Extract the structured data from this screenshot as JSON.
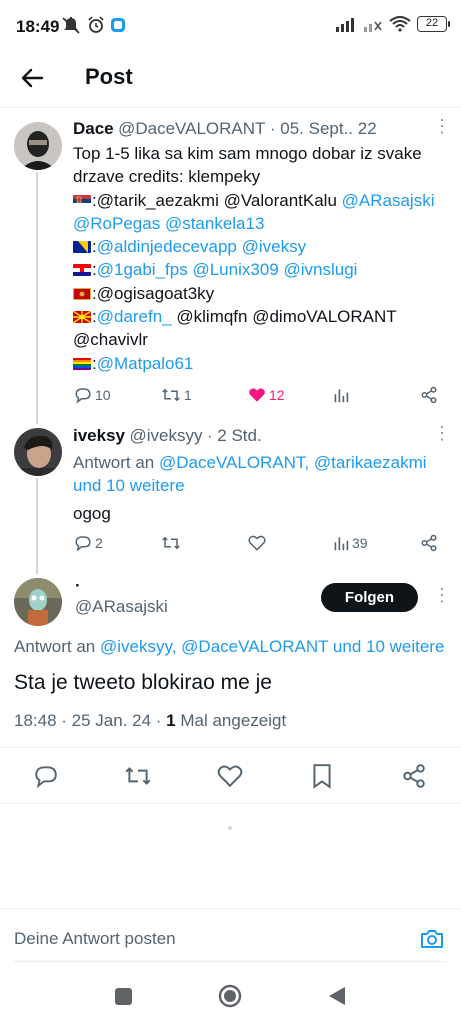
{
  "status": {
    "time": "18:49",
    "battery": "22"
  },
  "header": {
    "title": "Post"
  },
  "tweet1": {
    "name": "Dace",
    "handle": "@DaceVALORANT",
    "date": "· 05. Sept.. 22",
    "line1": "Top 1-5 lika sa kim sam mnogo dobar iz svake",
    "line2": "drzave credits: klempeky",
    "rs": ":@tarik_aezakmi @ValorantKalu ",
    "rs_m1": "@ARasajski",
    "rs_m2": "@RoPegas",
    "rs_m3": "@stankela13",
    "ba_pre": ":",
    "ba_m1": "@aldinjedecevapp",
    "ba_m2": "@iveksy",
    "hr_pre": ":",
    "hr_m1": "@1gabi_fps",
    "hr_m2": "@Lunix309",
    "hr_m3": "@ivnslugi",
    "me": ":@ogisagoat3ky",
    "mk_pre": ":",
    "mk_m1": "@darefn_",
    "mk_rest": " @klimqfn @dimoVALORANT",
    "mk_rest2": "@chavivlr",
    "rb_pre": ":",
    "rb_m1": "@Matpalo61",
    "replies": "10",
    "retweets": "1",
    "likes": "12",
    "colors": {
      "like": "#f91880"
    }
  },
  "tweet2": {
    "name": "iveksy",
    "handle": "@iveksyy",
    "time": "· 2 Std.",
    "reply_prefix": "Antwort an ",
    "reply_m1": "@DaceVALORANT,",
    "reply_m2": "@tarikaezakmi",
    "reply_more": "und 10 weitere",
    "text": "ogog",
    "replies": "2",
    "views": "39"
  },
  "main_tweet": {
    "name": "·",
    "handle": "@ARasajski",
    "follow_label": "Folgen",
    "reply_prefix": "Antwort an ",
    "reply_mentions": "@iveksyy, @DaceVALORANT und 10 weitere",
    "text": "Sta je tweeto blokirao me je",
    "meta_time": "18:48 · 25 Jan. 24 · ",
    "meta_count": "1",
    "meta_label": " Mal angezeigt"
  },
  "reply_box": {
    "placeholder": "Deine Antwort posten"
  },
  "icons": [
    "back-arrow-icon",
    "reply-icon",
    "retweet-icon",
    "like-icon",
    "views-icon",
    "share-icon",
    "bookmark-icon",
    "camera-icon",
    "more-icon"
  ]
}
